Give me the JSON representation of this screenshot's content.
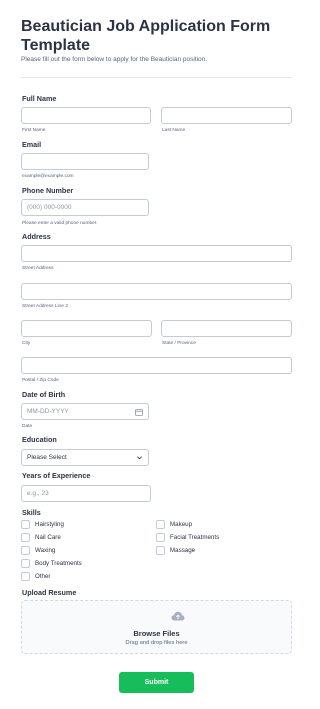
{
  "form": {
    "title": "Beautician Job Application Form Template",
    "subtitle": "Please fill out the form below to apply for the Beautician position."
  },
  "full_name": {
    "label": "Full Name",
    "first_sublabel": "First Name",
    "last_sublabel": "Last Name"
  },
  "email": {
    "label": "Email",
    "sublabel": "example@example.com"
  },
  "phone": {
    "label": "Phone Number",
    "placeholder": "(000) 000-0000",
    "sublabel": "Please enter a valid phone number."
  },
  "address": {
    "label": "Address",
    "street_sublabel": "Street Address",
    "street2_sublabel": "Street Address Line 2",
    "city_sublabel": "City",
    "state_sublabel": "State / Province",
    "zip_sublabel": "Postal / Zip Code"
  },
  "dob": {
    "label": "Date of Birth",
    "placeholder": "MM-DD-YYYY",
    "sublabel": "Date",
    "icon": "calendar-icon"
  },
  "education": {
    "label": "Education",
    "selected": "Please Select",
    "icon": "chevron-down-icon"
  },
  "experience": {
    "label": "Years of Experience",
    "placeholder": "e.g., 23"
  },
  "skills": {
    "label": "Skills",
    "options": [
      "Hairstyling",
      "Nail Care",
      "Waxing",
      "Body Treatments",
      "Other",
      "Makeup",
      "Facial Treatments",
      "Massage"
    ]
  },
  "upload": {
    "label": "Upload Resume",
    "browse": "Browse Files",
    "drag": "Drag and drop files here",
    "icon": "cloud-upload-icon"
  },
  "submit": {
    "label": "Submit",
    "color": "#18bd5b"
  }
}
